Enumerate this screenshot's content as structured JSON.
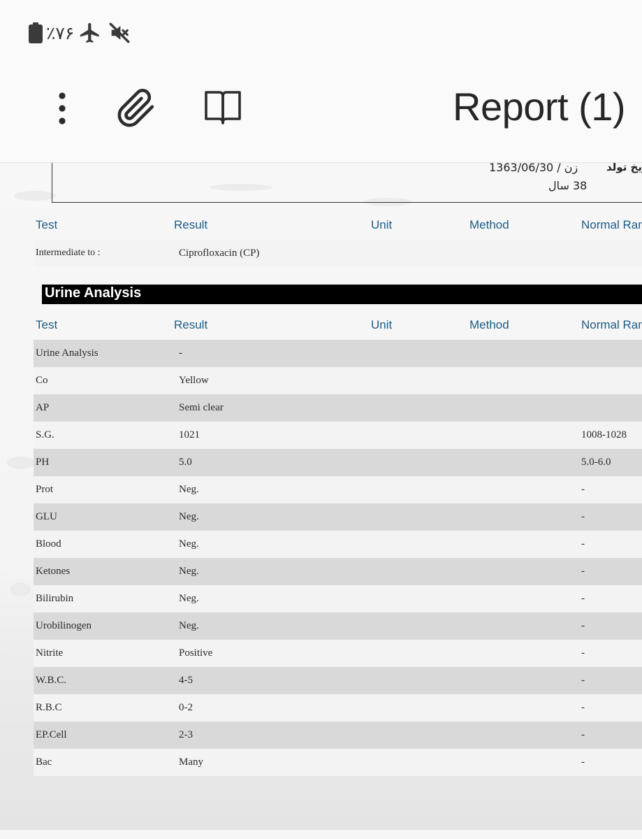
{
  "status_bar": {
    "battery_text": "٪۷۶",
    "icons": [
      "battery-icon",
      "airplane-mode-icon",
      "muted-icon"
    ]
  },
  "app_bar": {
    "title": "Report (1)",
    "icons": [
      "more-options-icon",
      "attachment-icon",
      "reading-mode-icon"
    ]
  },
  "patient": {
    "dob_label": "تاریخ تولد",
    "gender_dob": "زن / 1363/06/30",
    "age": "38 سال"
  },
  "columns": {
    "test": "Test",
    "result": "Result",
    "unit": "Unit",
    "method": "Method",
    "normal_range": "Normal Ran"
  },
  "antibiogram": {
    "rows": [
      {
        "test": "Intermediate to :",
        "result": "Ciprofloxacin (CP)"
      }
    ]
  },
  "urine_section": {
    "title": "Urine Analysis",
    "rows": [
      {
        "test": "Urine Analysis",
        "result": "-",
        "normal": ""
      },
      {
        "test": "Co",
        "result": "Yellow",
        "normal": ""
      },
      {
        "test": "AP",
        "result": "Semi clear",
        "normal": ""
      },
      {
        "test": "S.G.",
        "result": "1021",
        "normal": "1008-1028"
      },
      {
        "test": "PH",
        "result": "5.0",
        "normal": "5.0-6.0"
      },
      {
        "test": "Prot",
        "result": "Neg.",
        "normal": "-"
      },
      {
        "test": "GLU",
        "result": "Neg.",
        "normal": "-"
      },
      {
        "test": "Blood",
        "result": "Neg.",
        "normal": "-"
      },
      {
        "test": "Ketones",
        "result": "Neg.",
        "normal": "-"
      },
      {
        "test": "Bilirubin",
        "result": "Neg.",
        "normal": "-"
      },
      {
        "test": "Urobilinogen",
        "result": "Neg.",
        "normal": "-"
      },
      {
        "test": "Nitrite",
        "result": "Positive",
        "normal": "-"
      },
      {
        "test": "W.B.C.",
        "result": "4-5",
        "normal": "-"
      },
      {
        "test": "R.B.C",
        "result": "0-2",
        "normal": "-"
      },
      {
        "test": "EP.Cell",
        "result": "2-3",
        "normal": "-"
      },
      {
        "test": "Bac",
        "result": "Many",
        "normal": "-"
      }
    ]
  }
}
